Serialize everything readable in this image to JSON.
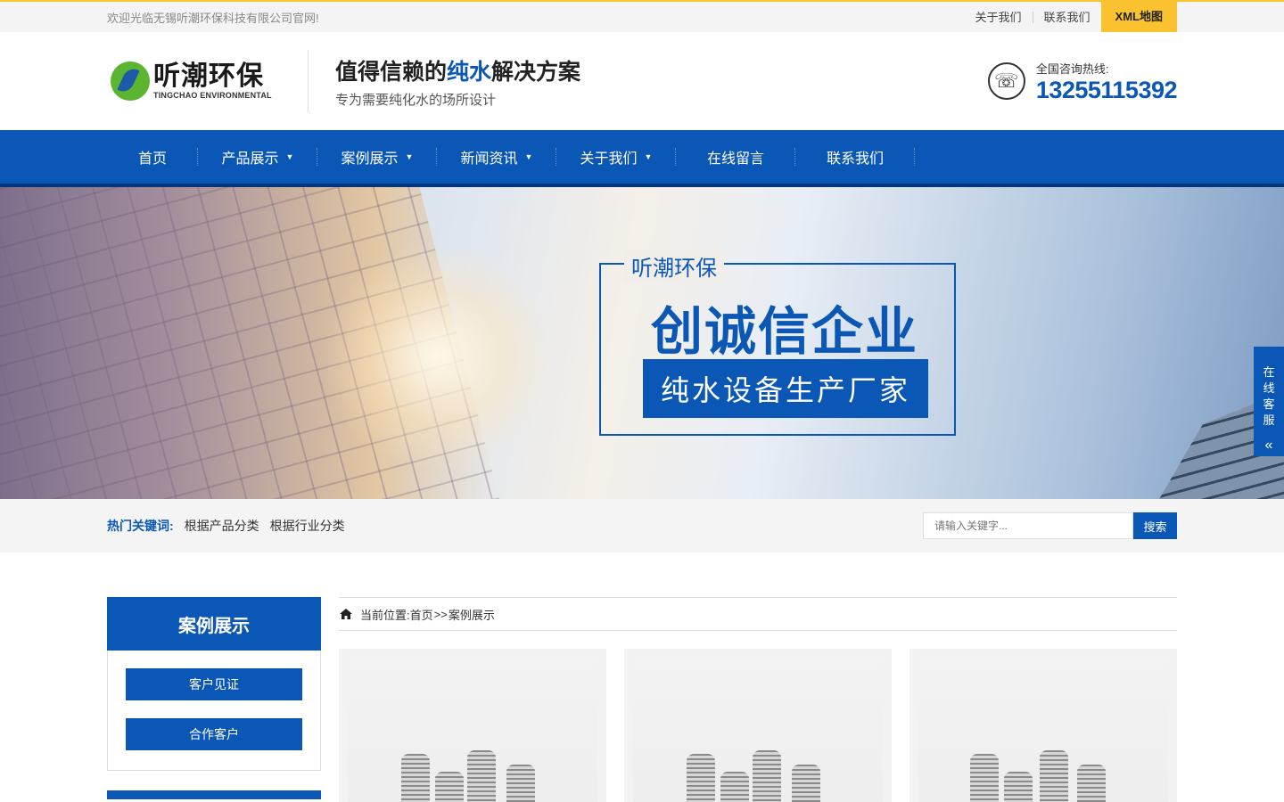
{
  "topbar": {
    "welcome": "欢迎光临无锡听潮环保科技有限公司官网!",
    "links": [
      "关于我们",
      "联系我们"
    ],
    "xml": "XML地图"
  },
  "header": {
    "logo_cn": "听潮环保",
    "logo_en": "TINGCHAO ENVIRONMENTAL",
    "slogan_pre": "值得信赖的",
    "slogan_hl": "纯水",
    "slogan_post": "解决方案",
    "slogan_sub": "专为需要纯化水的场所设计",
    "hotline_label": "全国咨询热线:",
    "hotline_number": "13255115392"
  },
  "nav": {
    "items": [
      {
        "label": "首页"
      },
      {
        "label": "产品展示"
      },
      {
        "label": "案例展示"
      },
      {
        "label": "新闻资讯"
      },
      {
        "label": "关于我们"
      },
      {
        "label": "在线留言"
      },
      {
        "label": "联系我们"
      }
    ],
    "caret": "▼"
  },
  "banner": {
    "brand": "听潮环保",
    "title": "创诚信企业",
    "tag": "纯水设备生产厂家"
  },
  "search": {
    "hot_label": "热门关键词:",
    "hot_items": [
      "根据产品分类",
      "根据行业分类"
    ],
    "placeholder": "请输入关键字...",
    "button": "搜索"
  },
  "sidebar": {
    "title": "案例展示",
    "items": [
      "客户见证",
      "合作客户"
    ]
  },
  "breadcrumb": {
    "prefix": "当前位置:",
    "home": "首页",
    "sep": ">>",
    "current": "案例展示"
  },
  "float_service": {
    "chars": [
      "在",
      "线",
      "客",
      "服"
    ],
    "arrow": "«"
  },
  "colors": {
    "primary": "#0b57b5",
    "accent": "#f9c22e"
  }
}
